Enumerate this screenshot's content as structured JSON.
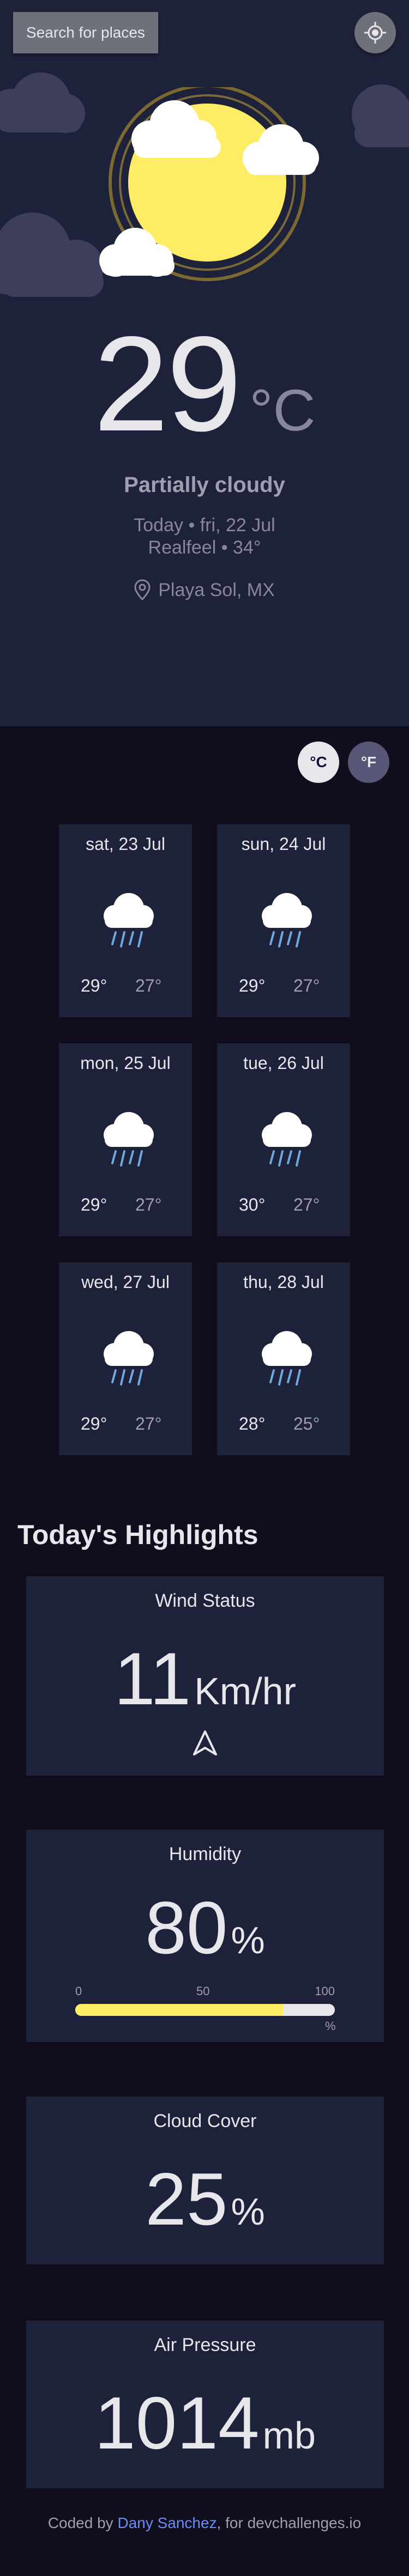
{
  "search": {
    "label": "Search for places"
  },
  "locate": {
    "icon": "gps-target-icon"
  },
  "current": {
    "temperature": "29",
    "unit": "°C",
    "condition": "Partially cloudy",
    "date": "Today • fri, 22 Jul",
    "realfeel": "Realfeel • 34°",
    "location": "Playa Sol, MX",
    "icon": "sun-with-clouds-icon"
  },
  "units": {
    "celsius": "°C",
    "fahrenheit": "°F",
    "active": "celsius"
  },
  "forecast": [
    {
      "day": "sat, 23 Jul",
      "max": "29°",
      "min": "27°",
      "icon": "rain-cloud-icon"
    },
    {
      "day": "sun, 24 Jul",
      "max": "29°",
      "min": "27°",
      "icon": "rain-cloud-icon"
    },
    {
      "day": "mon, 25 Jul",
      "max": "29°",
      "min": "27°",
      "icon": "rain-cloud-icon"
    },
    {
      "day": "tue, 26 Jul",
      "max": "30°",
      "min": "27°",
      "icon": "rain-cloud-icon"
    },
    {
      "day": "wed, 27 Jul",
      "max": "29°",
      "min": "27°",
      "icon": "rain-cloud-icon"
    },
    {
      "day": "thu, 28 Jul",
      "max": "28°",
      "min": "25°",
      "icon": "rain-cloud-icon"
    }
  ],
  "highlights": {
    "title": "Today's Highlights",
    "wind": {
      "label": "Wind Status",
      "value": "11",
      "unit": "Km/hr",
      "icon": "wind-direction-arrow-icon"
    },
    "humidity": {
      "label": "Humidity",
      "value": "80",
      "unit": "%",
      "scale": {
        "min": "0",
        "mid": "50",
        "max": "100",
        "pct": "%"
      },
      "fraction": 0.8
    },
    "cloud_cover": {
      "label": "Cloud Cover",
      "value": "25",
      "unit": "%"
    },
    "air_pressure": {
      "label": "Air Pressure",
      "value": "1014",
      "unit": "mb"
    }
  },
  "footer": {
    "prefix": "Coded by",
    "author": "Dany Sanchez",
    "suffix": ", for devchallenges.io"
  },
  "colors": {
    "sidebar": "#1e213a",
    "main": "#100e1d",
    "card": "#1e213a",
    "text": "#e7e7eb",
    "muted": "#88869d",
    "accent_yellow": "#ffec65",
    "link": "#6d8df6"
  }
}
